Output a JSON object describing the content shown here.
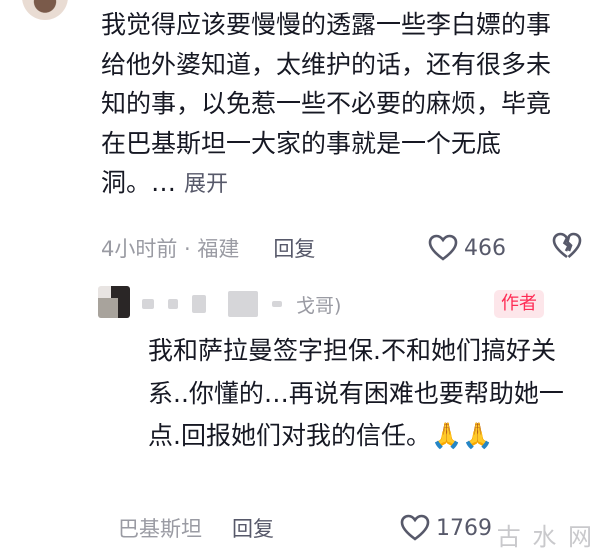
{
  "comment": {
    "text": "我觉得应该要慢慢的透露一些李白嫖的事给他外婆知道，太维护的话，还有很多未知的事，以免惹一些不必要的麻烦，毕竟在巴基斯坦一大家的事就是一个无底洞。…",
    "expand_label": "展开",
    "time_location": "4小时前 · 福建",
    "reply_label": "回复",
    "like_count": "466"
  },
  "reply": {
    "name_fragment": "戈哥)",
    "author_badge": "作者",
    "text": "我和萨拉曼签字担保.不和她们搞好关系..你懂的…再说有困难也要帮助她一点.回报她们对我的信任。🙏🙏",
    "location": "巴基斯坦",
    "reply_label": "回复",
    "like_count": "1769"
  },
  "watermark": "古 水 网",
  "colors": {
    "accent": "#fe2c55",
    "text": "#161823",
    "meta": "#9a9ba3"
  }
}
